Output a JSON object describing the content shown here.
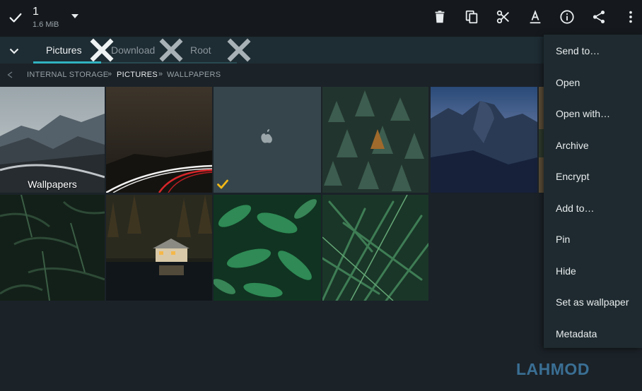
{
  "selection": {
    "count": "1",
    "size": "1.6 MiB"
  },
  "toolbar": {
    "icons": [
      "delete-icon",
      "copy-icon",
      "cut-icon",
      "rename-icon",
      "info-icon",
      "share-icon",
      "more-icon"
    ]
  },
  "tabs": [
    {
      "label": "Pictures",
      "active": true
    },
    {
      "label": "Download",
      "active": false
    },
    {
      "label": "Root",
      "active": false
    }
  ],
  "breadcrumb": {
    "items": [
      "INTERNAL STORAGE",
      "PICTURES",
      "WALLPAPERS"
    ],
    "separator": "»"
  },
  "grid": {
    "folder_caption": "Wallpapers",
    "selected_index": 2
  },
  "menu": {
    "items": [
      "Send to…",
      "Open",
      "Open with…",
      "Archive",
      "Encrypt",
      "Add to…",
      "Pin",
      "Hide",
      "Set as wallpaper",
      "Metadata"
    ]
  },
  "watermark": "LAHMOD",
  "colors": {
    "accent": "#30b2c0",
    "check": "#f2b818",
    "menu_bg": "#1e2a2f",
    "toolbar_bg": "#15191d"
  }
}
